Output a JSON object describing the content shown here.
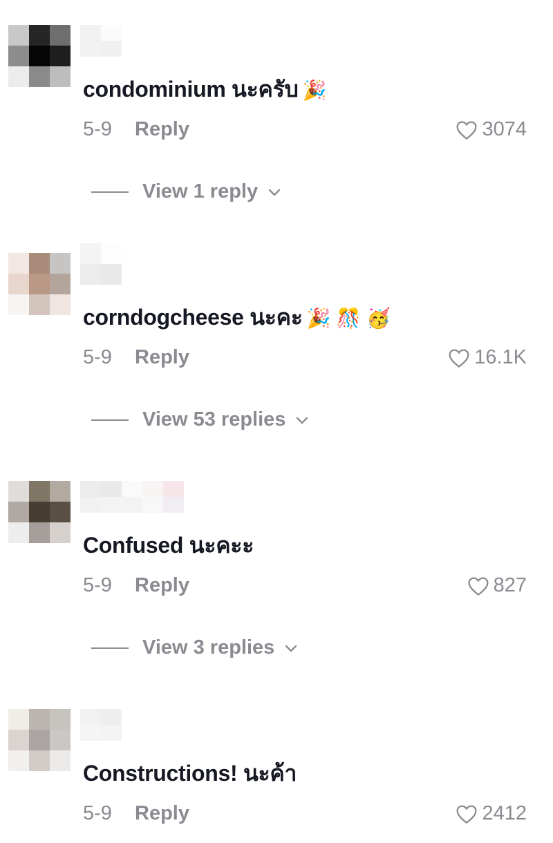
{
  "comments": [
    {
      "avatar_pixels": [
        "#c8c8c8",
        "#262626",
        "#6e6e6e",
        "#8c8c8c",
        "#050505",
        "#1e1e1e",
        "#ececec",
        "#8a8a8a",
        "#bdbdbd"
      ],
      "username_pixels": [
        "#f1f1f1",
        "#fbfbfb",
        "#ffffff",
        "#ffffff",
        "#ffffff",
        "#f2f2f2",
        "#f0f0f0",
        "#ffffff",
        "#ffffff",
        "#ffffff"
      ],
      "text": "condominium นะครับ",
      "emojis": "🎉",
      "date": "5-9",
      "reply_label": "Reply",
      "likes": "3074",
      "view_replies": "View 1 reply"
    },
    {
      "avatar_pixels": [
        "#f2e7e2",
        "#a88b78",
        "#c7c5c4",
        "#e8d6cc",
        "#b99886",
        "#b3a59c",
        "#f7f4f3",
        "#d3c4bc",
        "#f0e5e1"
      ],
      "username_pixels": [
        "#f4f4f4",
        "#fdfdfd",
        "#ffffff",
        "#ffffff",
        "#ffffff",
        "#ececec",
        "#e9e9ea",
        "#ffffff",
        "#ffffff",
        "#ffffff"
      ],
      "text": "corndogcheese นะคะ",
      "emojis": "🎉 🎊 🥳",
      "date": "5-9",
      "reply_label": "Reply",
      "likes": "16.1K",
      "view_replies": "View 53 replies"
    },
    {
      "avatar_pixels": [
        "#dfdcd9",
        "#7f7665",
        "#b2aaa0",
        "#b0a8a3",
        "#463c31",
        "#5a4f45",
        "#eeeded",
        "#a49d99",
        "#d7d1cd"
      ],
      "username_pixels": [
        "#ececec",
        "#e9e9e9",
        "#fafafa",
        "#f8f4f4",
        "#f6e6e9",
        "#f1f1f1",
        "#f3f3f3",
        "#f3f3f3",
        "#f8f8f8",
        "#f1edf2"
      ],
      "text": "Confused นะคะะ",
      "emojis": "",
      "date": "5-9",
      "reply_label": "Reply",
      "likes": "827",
      "view_replies": "View 3 replies"
    },
    {
      "avatar_pixels": [
        "#f0ede8",
        "#bdb6b0",
        "#c7c3bf",
        "#dad3cf",
        "#aaa5a2",
        "#cbc7c4",
        "#f1f0ef",
        "#d2cbc7",
        "#ecebea"
      ],
      "username_pixels": [
        "#f1f1f1",
        "#eeeeee",
        "#ffffff",
        "#ffffff",
        "#ffffff",
        "#f5f5f5",
        "#f3f3f3",
        "#ffffff",
        "#ffffff",
        "#ffffff"
      ],
      "text": "Constructions! นะค้า",
      "emojis": "",
      "date": "5-9",
      "reply_label": "Reply",
      "likes": "2412",
      "view_replies": ""
    }
  ]
}
